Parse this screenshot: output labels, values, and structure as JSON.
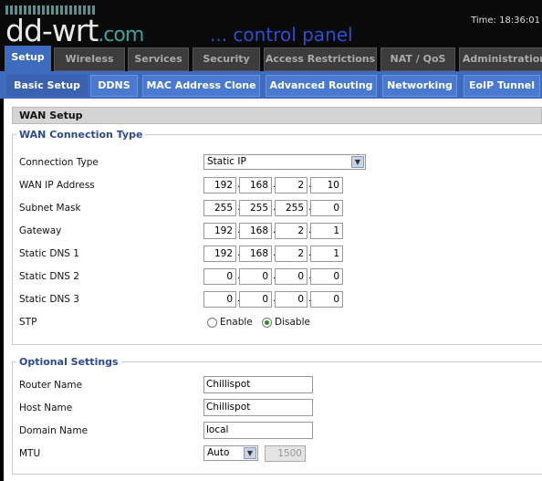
{
  "header": {
    "logo": "dd-wrt",
    "logo_suffix": ".com",
    "subtitle": "... control panel",
    "time": "Time: 18:36:01"
  },
  "tabs": [
    "Setup",
    "Wireless",
    "Services",
    "Security",
    "Access Restrictions",
    "NAT / QoS",
    "Administration"
  ],
  "subtabs": [
    "Basic Setup",
    "DDNS",
    "MAC Address Clone",
    "Advanced Routing",
    "Networking",
    "EoIP Tunnel"
  ],
  "section_title": "WAN Setup",
  "wan": {
    "legend": "WAN Connection Type",
    "connection_type_label": "Connection Type",
    "connection_type": "Static IP",
    "ip_label": "WAN IP Address",
    "ip": [
      "192",
      "168",
      "2",
      "10"
    ],
    "mask_label": "Subnet Mask",
    "mask": [
      "255",
      "255",
      "255",
      "0"
    ],
    "gw_label": "Gateway",
    "gw": [
      "192",
      "168",
      "2",
      "1"
    ],
    "dns1_label": "Static DNS 1",
    "dns1": [
      "192",
      "168",
      "2",
      "1"
    ],
    "dns2_label": "Static DNS 2",
    "dns2": [
      "0",
      "0",
      "0",
      "0"
    ],
    "dns3_label": "Static DNS 3",
    "dns3": [
      "0",
      "0",
      "0",
      "0"
    ],
    "stp_label": "STP",
    "stp_enable": "Enable",
    "stp_disable": "Disable",
    "stp_value": "Disable"
  },
  "optional": {
    "legend": "Optional Settings",
    "router_name_label": "Router Name",
    "router_name": "Chillispot",
    "host_name_label": "Host Name",
    "host_name": "Chillispot",
    "domain_label": "Domain Name",
    "domain": "local",
    "mtu_label": "MTU",
    "mtu_mode": "Auto",
    "mtu_value": "1500"
  }
}
